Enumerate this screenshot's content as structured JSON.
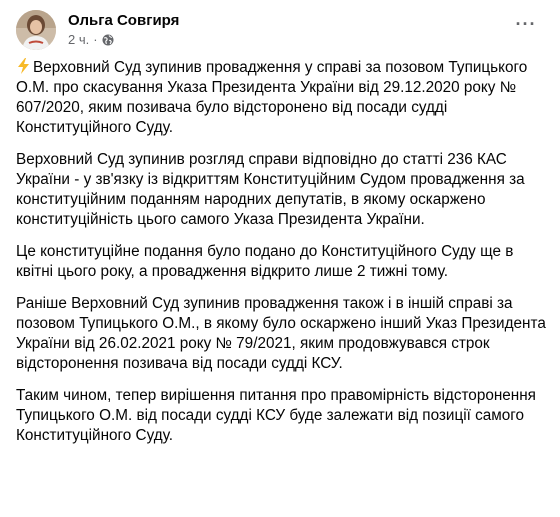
{
  "post": {
    "author": "Ольга Совгиря",
    "time": "2 ч.",
    "separator": "·",
    "privacy_icon": "globe-icon",
    "more_icon": "more-horizontal-icon",
    "lead_icon": "lightning-icon",
    "paragraphs": [
      "Верховний Суд зупинив провадження у справі за позовом Тупицького О.М. про скасування Указа Президента України від 29.12.2020 року № 607/2020, яким позивача було відсторонено від посади судді Конституційного Суду.",
      "Верховний Суд зупинив розгляд справи відповідно до статті 236 КАС України - у зв'язку із відкриттям Конституційним Судом провадження за конституційним поданням народних депутатів, в якому оскаржено конституційність цього самого Указа Президента України.",
      "Це конституційне подання було подано до Конституційного Суду ще в квітні цього року, а провадження відкрито лише 2 тижні тому.",
      "Раніше Верховний Суд зупинив провадження також і в іншій справі за позовом Тупицького О.М., в якому було оскаржено інший Указ Президента України від 26.02.2021 року № 79/2021, яким продовжувався строк відсторонення позивача від посади судді КСУ.",
      "Таким чином, тепер вирішення питання про правомірність відсторонення Тупицького О.М. від посади судді КСУ буде залежати від позиції самого Конституційного Суду."
    ]
  },
  "colors": {
    "text": "#050505",
    "secondary": "#65676b",
    "lightning": "#f7b928"
  }
}
